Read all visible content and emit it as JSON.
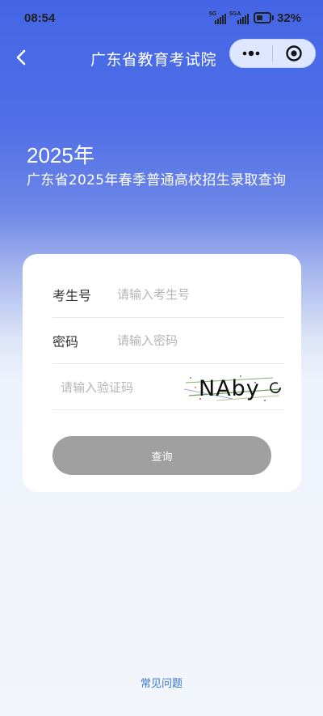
{
  "status_bar": {
    "time": "08:54",
    "signal1_label": "5G",
    "signal2_label": "5GA",
    "battery_percent": "32%",
    "battery_level": 0.32
  },
  "nav": {
    "title": "广东省教育考试院",
    "back_icon": "chevron-left-icon",
    "more_icon": "more-dots-icon",
    "close_icon": "target-circle-icon"
  },
  "header": {
    "year": "2025年",
    "subtitle": "广东省2025年春季普通高校招生录取查询"
  },
  "form": {
    "candidate_label": "考生号",
    "candidate_placeholder": "请输入考生号",
    "password_label": "密码",
    "password_placeholder": "请输入密码",
    "captcha_placeholder": "请输入验证码",
    "captcha_text": "NAby",
    "submit_label": "查询"
  },
  "footer": {
    "faq_label": "常见问题"
  },
  "colors": {
    "header_blue": "#4466e6",
    "button_gray": "#a0a0a0",
    "link_blue": "#3a78c8"
  }
}
